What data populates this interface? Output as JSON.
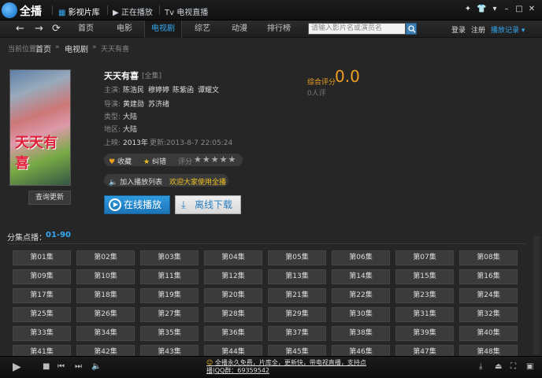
{
  "app": {
    "name": "全播"
  },
  "top_nav": [
    {
      "label": "影视片库",
      "icon": "grid-icon"
    },
    {
      "label": "正在播放",
      "icon": "play-icon"
    },
    {
      "label": "Tv 电视直播",
      "icon": "tv-icon"
    }
  ],
  "window_controls": [
    "pin-icon",
    "skin-icon",
    "menu-icon",
    "minimize-icon",
    "maximize-icon",
    "close-icon"
  ],
  "nav": {
    "tabs": [
      "首页",
      "电影",
      "电视剧",
      "综艺",
      "动漫",
      "排行榜"
    ],
    "active_tab": "电视剧",
    "search_placeholder": "请输入影片名或演员名",
    "login": "登录",
    "register": "注册",
    "history": "播放记录"
  },
  "breadcrumb": {
    "prefix": "当前位置:",
    "home": "首页",
    "section": "电视剧",
    "current": "天天有喜"
  },
  "poster": {
    "title_text": "天天有喜"
  },
  "query_update_label": "查询更新",
  "show": {
    "title": "天天有喜",
    "status_tag": "[全集]",
    "cast_label": "主演:",
    "cast": [
      "陈浩民",
      "穆婷婷",
      "陈紫函",
      "谭耀文"
    ],
    "director_label": "导演:",
    "directors": [
      "黄建勋",
      "苏济绪"
    ],
    "genre_label": "类型:",
    "genre": "大陆",
    "region_label": "地区:",
    "region": "大陆",
    "release_label": "上映:",
    "release": "2013年",
    "updated": "更新:2013-8-7 22:05:24"
  },
  "rating": {
    "label": "综合评分",
    "value": "0.0",
    "count": "0人评",
    "stars": 5,
    "score_label": "评分"
  },
  "actions": {
    "favorite": "收藏",
    "report": "纠错",
    "add_playlist": "加入播放列表",
    "welcome": "欢迎大家使用全播"
  },
  "buttons": {
    "play": "在线播放",
    "download": "离线下载"
  },
  "episodes": {
    "title": "分集点播：",
    "range": "01-90",
    "labels": [
      "第01集",
      "第02集",
      "第03集",
      "第04集",
      "第05集",
      "第06集",
      "第07集",
      "第08集",
      "第09集",
      "第10集",
      "第11集",
      "第12集",
      "第13集",
      "第14集",
      "第15集",
      "第16集",
      "第17集",
      "第18集",
      "第19集",
      "第20集",
      "第21集",
      "第22集",
      "第23集",
      "第24集",
      "第25集",
      "第26集",
      "第27集",
      "第28集",
      "第29集",
      "第30集",
      "第31集",
      "第32集",
      "第33集",
      "第34集",
      "第35集",
      "第36集",
      "第37集",
      "第38集",
      "第39集",
      "第40集",
      "第41集",
      "第42集",
      "第43集",
      "第44集",
      "第45集",
      "第46集",
      "第47集",
      "第48集"
    ]
  },
  "footer": {
    "notice": "全播永久免费，片库全，更新快，带电视直播，支持点播|QQ群：69359542"
  },
  "colors": {
    "accent": "#35a8f0",
    "rating": "#f0a020",
    "play_button": "#2f9be0"
  }
}
